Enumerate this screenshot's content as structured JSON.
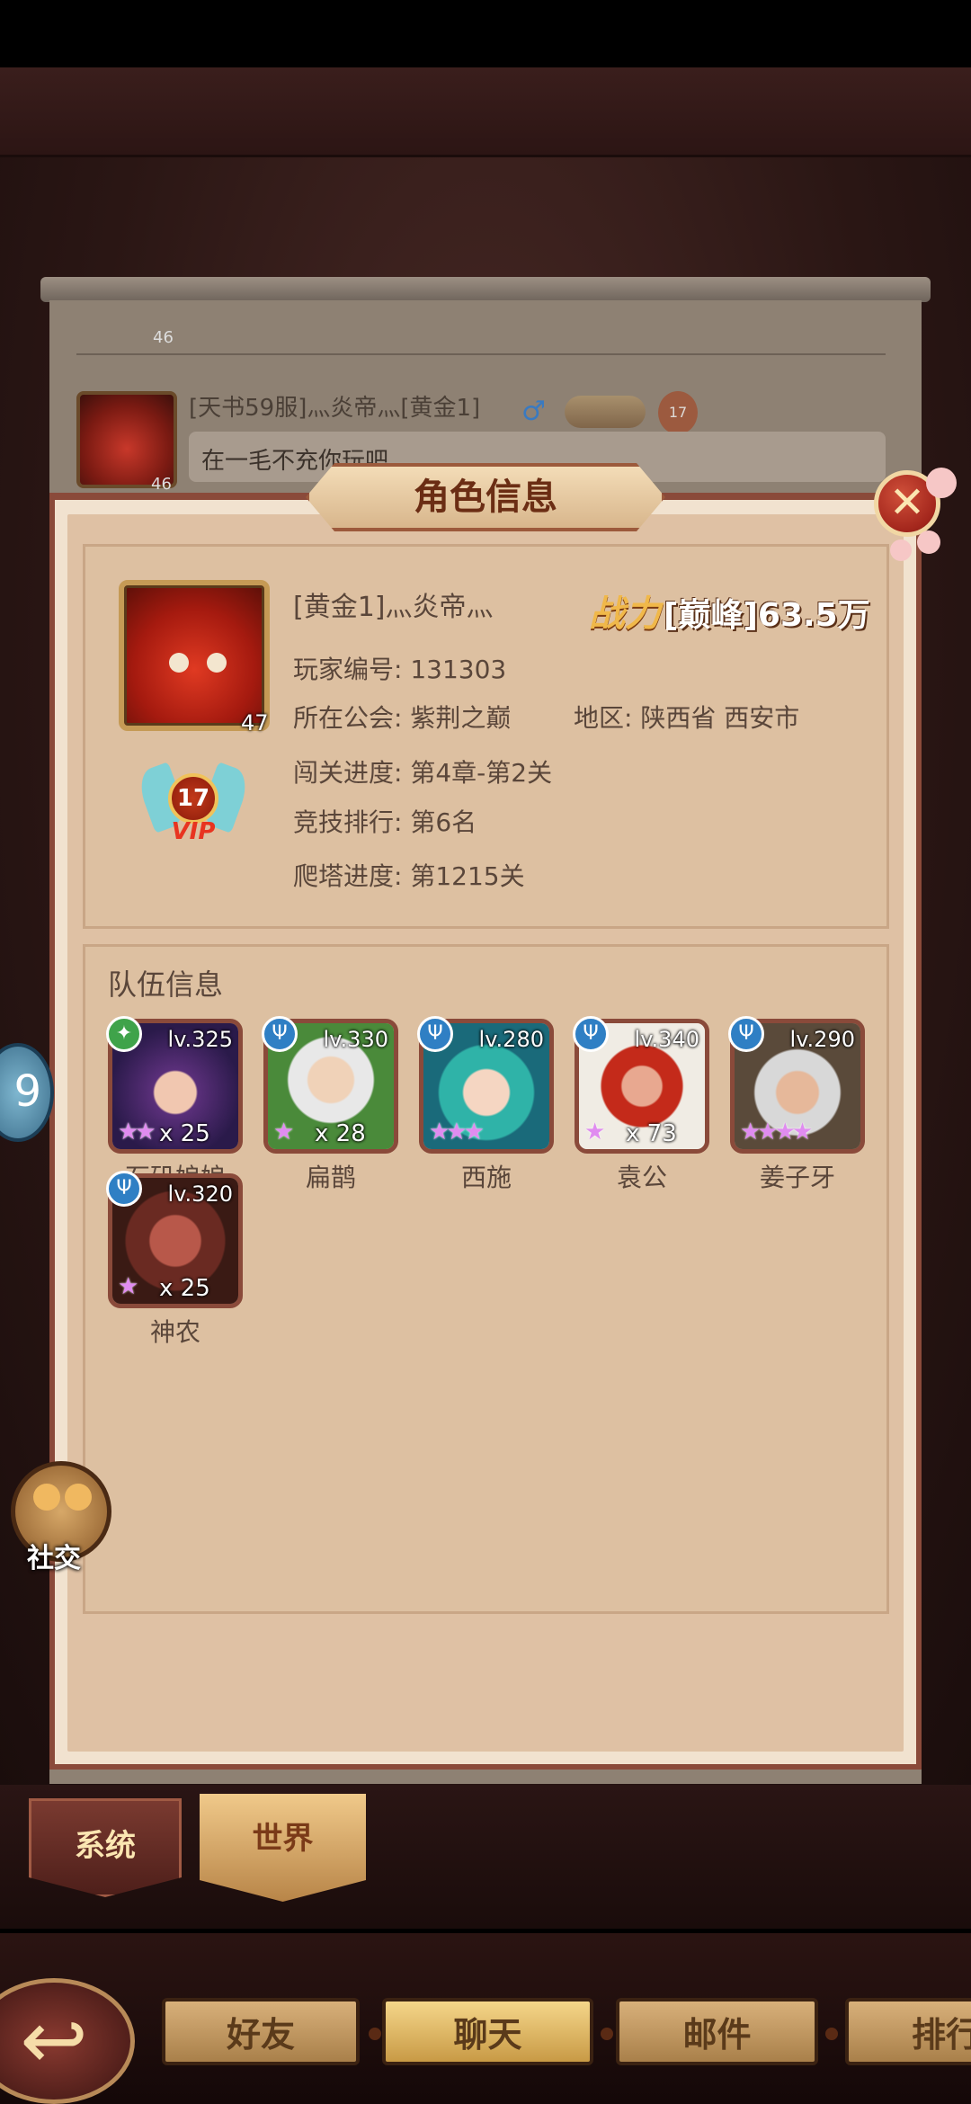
{
  "chat": {
    "top_level": "46",
    "message": {
      "avatar_level": "46",
      "sender": "[天书59服]灬炎帝灬[黄金1]",
      "gender_symbol": "♂",
      "vip_level": "17",
      "text": "在一毛不充你玩吧"
    }
  },
  "dialog": {
    "title": "角色信息",
    "close_symbol": "✕",
    "profile": {
      "avatar_level": "47",
      "vip_level": "17",
      "vip_text": "VIP",
      "name": "[黄金1]灬炎帝灬",
      "power_label": "战力",
      "power_value": "[巅峰]63.5万",
      "player_id": "玩家编号: 131303",
      "guild": "所在公会: 紫荆之巅",
      "region": "地区: 陕西省 西安市",
      "stage_progress": "闯关进度: 第4章-第2关",
      "arena_rank": "竞技排行: 第6名",
      "tower_progress": "爬塔进度: 第1215关"
    },
    "team": {
      "title": "队伍信息",
      "heroes": [
        {
          "name": "石矶娘娘",
          "level": "lv.325",
          "count": "x 25",
          "stars": "★★",
          "type_color": "#3fa34a"
        },
        {
          "name": "扁鹊",
          "level": "lv.330",
          "count": "x 28",
          "stars": "★",
          "type_color": "#2f7fc4"
        },
        {
          "name": "西施",
          "level": "lv.280",
          "count": "",
          "stars": "★★★",
          "type_color": "#2f7fc4"
        },
        {
          "name": "袁公",
          "level": "lv.340",
          "count": "x 73",
          "stars": "★",
          "type_color": "#2f7fc4"
        },
        {
          "name": "姜子牙",
          "level": "lv.290",
          "count": "",
          "stars": "★★★★",
          "type_color": "#2f7fc4"
        },
        {
          "name": "神农",
          "level": "lv.320",
          "count": "x 25",
          "stars": "★",
          "type_color": "#2f7fc4"
        }
      ]
    }
  },
  "side": {
    "social_label": "社交",
    "left_chip": "9"
  },
  "chat_tabs": {
    "system": "系统",
    "world": "世界"
  },
  "bottom_nav": {
    "back_icon": "↩",
    "friends": "好友",
    "chat": "聊天",
    "mail": "邮件",
    "rank": "排行"
  }
}
